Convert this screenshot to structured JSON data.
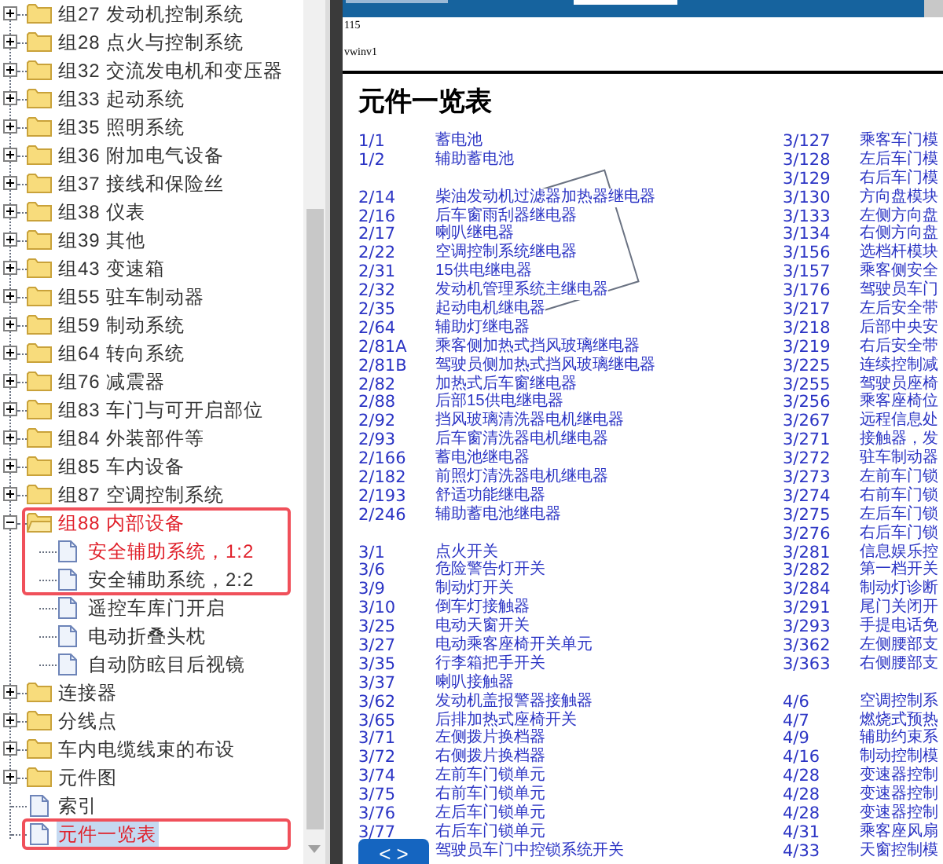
{
  "tree": [
    {
      "kind": "folder",
      "label": "组27 发动机控制系统",
      "expanded": false,
      "highlighted": false,
      "selected": false,
      "annotated": false
    },
    {
      "kind": "folder",
      "label": "组28 点火与控制系统",
      "expanded": false,
      "highlighted": false,
      "selected": false,
      "annotated": false
    },
    {
      "kind": "folder",
      "label": "组32 交流发电机和变压器",
      "expanded": false,
      "highlighted": false,
      "selected": false,
      "annotated": false
    },
    {
      "kind": "folder",
      "label": "组33 起动系统",
      "expanded": false,
      "highlighted": false,
      "selected": false,
      "annotated": false
    },
    {
      "kind": "folder",
      "label": "组35 照明系统",
      "expanded": false,
      "highlighted": false,
      "selected": false,
      "annotated": false
    },
    {
      "kind": "folder",
      "label": "组36 附加电气设备",
      "expanded": false,
      "highlighted": false,
      "selected": false,
      "annotated": false
    },
    {
      "kind": "folder",
      "label": "组37 接线和保险丝",
      "expanded": false,
      "highlighted": false,
      "selected": false,
      "annotated": false
    },
    {
      "kind": "folder",
      "label": "组38 仪表",
      "expanded": false,
      "highlighted": false,
      "selected": false,
      "annotated": false
    },
    {
      "kind": "folder",
      "label": "组39 其他",
      "expanded": false,
      "highlighted": false,
      "selected": false,
      "annotated": false
    },
    {
      "kind": "folder",
      "label": "组43 变速箱",
      "expanded": false,
      "highlighted": false,
      "selected": false,
      "annotated": false
    },
    {
      "kind": "folder",
      "label": "组55 驻车制动器",
      "expanded": false,
      "highlighted": false,
      "selected": false,
      "annotated": false
    },
    {
      "kind": "folder",
      "label": "组59 制动系统",
      "expanded": false,
      "highlighted": false,
      "selected": false,
      "annotated": false
    },
    {
      "kind": "folder",
      "label": "组64 转向系统",
      "expanded": false,
      "highlighted": false,
      "selected": false,
      "annotated": false
    },
    {
      "kind": "folder",
      "label": "组76 减震器",
      "expanded": false,
      "highlighted": false,
      "selected": false,
      "annotated": false
    },
    {
      "kind": "folder",
      "label": "组83 车门与可开启部位",
      "expanded": false,
      "highlighted": false,
      "selected": false,
      "annotated": false
    },
    {
      "kind": "folder",
      "label": "组84 外装部件等",
      "expanded": false,
      "highlighted": false,
      "selected": false,
      "annotated": false
    },
    {
      "kind": "folder",
      "label": "组85 车内设备",
      "expanded": false,
      "highlighted": false,
      "selected": false,
      "annotated": false
    },
    {
      "kind": "folder",
      "label": "组87 空调控制系统",
      "expanded": false,
      "highlighted": false,
      "selected": false,
      "annotated": false
    },
    {
      "kind": "folder",
      "label": "组88 内部设备",
      "expanded": true,
      "highlighted": true,
      "selected": false,
      "annotated": true,
      "children": [
        {
          "kind": "document",
          "label": "安全辅助系统，1:2",
          "highlighted": true,
          "selected": false,
          "annotated": true
        },
        {
          "kind": "document",
          "label": "安全辅助系统，2:2",
          "highlighted": false,
          "selected": false,
          "annotated": true
        },
        {
          "kind": "document",
          "label": "遥控车库门开启",
          "highlighted": false,
          "selected": false,
          "annotated": false
        },
        {
          "kind": "document",
          "label": "电动折叠头枕",
          "highlighted": false,
          "selected": false,
          "annotated": false
        },
        {
          "kind": "document",
          "label": "自动防眩目后视镜",
          "highlighted": false,
          "selected": false,
          "annotated": false
        }
      ]
    },
    {
      "kind": "folder",
      "label": "连接器",
      "expanded": false,
      "highlighted": false,
      "selected": false,
      "annotated": false
    },
    {
      "kind": "folder",
      "label": "分线点",
      "expanded": false,
      "highlighted": false,
      "selected": false,
      "annotated": false
    },
    {
      "kind": "folder",
      "label": "车内电缆线束的布设",
      "expanded": false,
      "highlighted": false,
      "selected": false,
      "annotated": false
    },
    {
      "kind": "folder",
      "label": "元件图",
      "expanded": false,
      "highlighted": false,
      "selected": false,
      "annotated": false
    },
    {
      "kind": "document",
      "label": "索引",
      "highlighted": false,
      "selected": false,
      "annotated": false
    },
    {
      "kind": "document",
      "label": "元件一览表",
      "highlighted": true,
      "selected": true,
      "annotated": true
    }
  ],
  "document": {
    "header_lines": [
      "115",
      "vwinv1"
    ],
    "title": "元件一览表",
    "nav_button": "< >",
    "columns": [
      {
        "groups": [
          {
            "entries": [
              {
                "code": "1/1",
                "name": "蓄电池"
              },
              {
                "code": "1/2",
                "name": "辅助蓄电池"
              }
            ]
          },
          {
            "entries": [
              {
                "code": "2/14",
                "name": "柴油发动机过滤器加热器继电器"
              },
              {
                "code": "2/16",
                "name": "后车窗雨刮器继电器"
              },
              {
                "code": "2/17",
                "name": "喇叭继电器"
              },
              {
                "code": "2/22",
                "name": "空调控制系统继电器"
              },
              {
                "code": "2/31",
                "name": "15供电继电器"
              },
              {
                "code": "2/32",
                "name": "发动机管理系统主继电器"
              },
              {
                "code": "2/35",
                "name": "起动电机继电器"
              },
              {
                "code": "2/64",
                "name": "辅助灯继电器"
              },
              {
                "code": "2/81A",
                "name": "乘客侧加热式挡风玻璃继电器"
              },
              {
                "code": "2/81B",
                "name": "驾驶员侧加热式挡风玻璃继电器"
              },
              {
                "code": "2/82",
                "name": "加热式后车窗继电器"
              },
              {
                "code": "2/88",
                "name": "后部15供电继电器"
              },
              {
                "code": "2/92",
                "name": "挡风玻璃清洗器电机继电器"
              },
              {
                "code": "2/93",
                "name": "后车窗清洗器电机继电器"
              },
              {
                "code": "2/166",
                "name": "蓄电池继电器"
              },
              {
                "code": "2/182",
                "name": "前照灯清洗器电机继电器"
              },
              {
                "code": "2/193",
                "name": "舒适功能继电器"
              },
              {
                "code": "2/246",
                "name": "辅助蓄电池继电器"
              }
            ]
          },
          {
            "entries": [
              {
                "code": "3/1",
                "name": "点火开关"
              },
              {
                "code": "3/6",
                "name": "危险警告灯开关"
              },
              {
                "code": "3/9",
                "name": "制动灯开关"
              },
              {
                "code": "3/10",
                "name": "倒车灯接触器"
              },
              {
                "code": "3/25",
                "name": "电动天窗开关"
              },
              {
                "code": "3/27",
                "name": "电动乘客座椅开关单元"
              },
              {
                "code": "3/35",
                "name": "行李箱把手开关"
              },
              {
                "code": "3/37",
                "name": "喇叭接触器"
              },
              {
                "code": "3/62",
                "name": "发动机盖报警器接触器"
              },
              {
                "code": "3/65",
                "name": "后排加热式座椅开关"
              },
              {
                "code": "3/71",
                "name": "左侧拨片换档器"
              },
              {
                "code": "3/72",
                "name": "右侧拨片换档器"
              },
              {
                "code": "3/74",
                "name": "左前车门锁单元"
              },
              {
                "code": "3/75",
                "name": "右前车门锁单元"
              },
              {
                "code": "3/76",
                "name": "左后车门锁单元"
              },
              {
                "code": "3/77",
                "name": "右后车门锁单元"
              },
              {
                "name": "驾驶员车门中控锁系统开关"
              }
            ]
          }
        ]
      },
      {
        "groups": [
          {
            "entries": [
              {
                "code": "3/127",
                "name": "乘客车门模"
              },
              {
                "code": "3/128",
                "name": "左后车门模"
              },
              {
                "code": "3/129",
                "name": "右后车门模"
              },
              {
                "code": "3/130",
                "name": "方向盘模块"
              },
              {
                "code": "3/133",
                "name": "左侧方向盘"
              },
              {
                "code": "3/134",
                "name": "右侧方向盘"
              },
              {
                "code": "3/156",
                "name": "选档杆模块"
              },
              {
                "code": "3/157",
                "name": "乘客侧安全"
              },
              {
                "code": "3/176",
                "name": "驾驶员车门"
              },
              {
                "code": "3/217",
                "name": "左后安全带"
              },
              {
                "code": "3/218",
                "name": "后部中央安"
              },
              {
                "code": "3/219",
                "name": "右后安全带"
              },
              {
                "code": "3/225",
                "name": "连续控制减"
              },
              {
                "code": "3/255",
                "name": "驾驶员座椅"
              },
              {
                "code": "3/256",
                "name": "乘客座椅位"
              },
              {
                "code": "3/267",
                "name": "远程信息处"
              },
              {
                "code": "3/271",
                "name": "接触器，发"
              },
              {
                "code": "3/272",
                "name": "驻车制动器"
              },
              {
                "code": "3/273",
                "name": "左前车门锁"
              },
              {
                "code": "3/274",
                "name": "右前车门锁"
              },
              {
                "code": "3/275",
                "name": "左后车门锁"
              },
              {
                "code": "3/276",
                "name": "右后车门锁"
              },
              {
                "code": "3/281",
                "name": "信息娱乐控"
              },
              {
                "code": "3/282",
                "name": "第一档开关"
              },
              {
                "code": "3/284",
                "name": "制动灯诊断"
              },
              {
                "code": "3/291",
                "name": "尾门关闭开"
              },
              {
                "code": "3/293",
                "name": "手提电话免"
              },
              {
                "code": "3/362",
                "name": "左侧腰部支"
              },
              {
                "code": "3/363",
                "name": "右侧腰部支"
              }
            ]
          },
          {
            "entries": [
              {
                "code": "4/6",
                "name": "空调控制系"
              },
              {
                "code": "4/7",
                "name": "燃烧式预热"
              },
              {
                "code": "4/9",
                "name": "辅助约束系"
              },
              {
                "code": "4/16",
                "name": "制动控制模"
              },
              {
                "code": "4/28",
                "name": "变速器控制"
              },
              {
                "code": "4/28",
                "name": "变速器控制"
              },
              {
                "code": "4/28",
                "name": "变速器控制"
              },
              {
                "code": "4/31",
                "name": "乘客座风扇"
              },
              {
                "code": "4/33",
                "name": "天窗控制模"
              }
            ]
          }
        ]
      }
    ]
  }
}
